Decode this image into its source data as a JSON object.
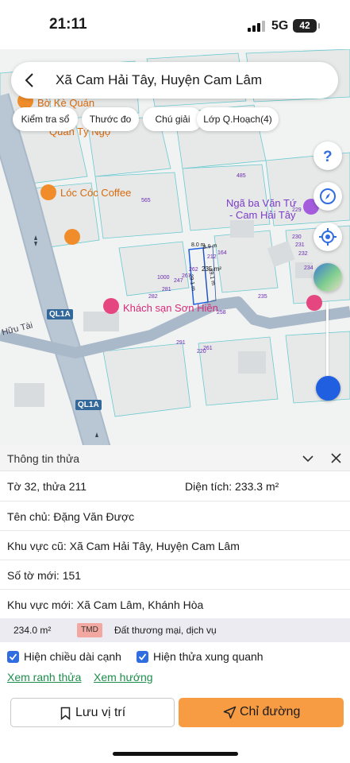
{
  "status_bar": {
    "time": "21:11",
    "network": "5G",
    "battery": "42"
  },
  "search": {
    "title": "Xã Cam Hải Tây, Huyện Cam Lâm"
  },
  "chips": [
    "Kiểm tra sổ",
    "Thước đo",
    "Chú giải",
    "Lớp Q.Hoạch(4)"
  ],
  "map": {
    "pois": {
      "bo_ke_quan": "Bờ Kè Quán",
      "quan_ty_ngo": "Quán Tý Ngọ",
      "loc_coc": "Lóc Cóc Coffee",
      "nga_ba_line1": "Ngã ba Văn Tứ",
      "nga_ba_line2": "- Cam Hải Tây",
      "khach_san": "Khách sạn Sơn Hiền"
    },
    "roads": {
      "ql1a_1": "QL1A",
      "ql1a_2": "QL1A",
      "street": "Hữu Tài"
    },
    "parcel_numbers": [
      "485",
      "565",
      "229",
      "230",
      "231",
      "232",
      "234",
      "164",
      "212",
      "235",
      "1000",
      "247",
      "262",
      "267",
      "281",
      "282",
      "235",
      "258",
      "291",
      "220",
      "261"
    ],
    "dimensions": [
      "8.0 m",
      "8.9 m",
      "29.1 m",
      "29.1 m"
    ],
    "parcel_label": "235 m²",
    "colors": {
      "road": "#a9b9c9",
      "parcel_line": "#66c8cf",
      "accent_blue": "#1f5fe0"
    }
  },
  "sheet": {
    "title": "Thông tin thửa",
    "sheet_parcel": "Tờ 32, thửa 211",
    "area_label": "Diện tích: 233.3 m²",
    "owner": "Tên chủ: Đặng Văn Được",
    "old_region": "Khu vực cũ: Xã Cam Hải Tây, Huyện Cam Lâm",
    "new_sheet": "Số tờ mới: 151",
    "new_region": "Khu vực mới: Xã Cam Lâm, Khánh Hòa",
    "land_area": "234.0 m²",
    "land_code": "TMD",
    "land_type": "Đất thương mại, dịch vụ",
    "show_edges": "Hiện chiều dài cạnh",
    "show_neighbors": "Hiện thửa xung quanh",
    "link_boundary": "Xem ranh thửa",
    "link_direction": "Xem hướng",
    "save_button": "Lưu vị trí",
    "direction_button": "Chỉ đường"
  }
}
